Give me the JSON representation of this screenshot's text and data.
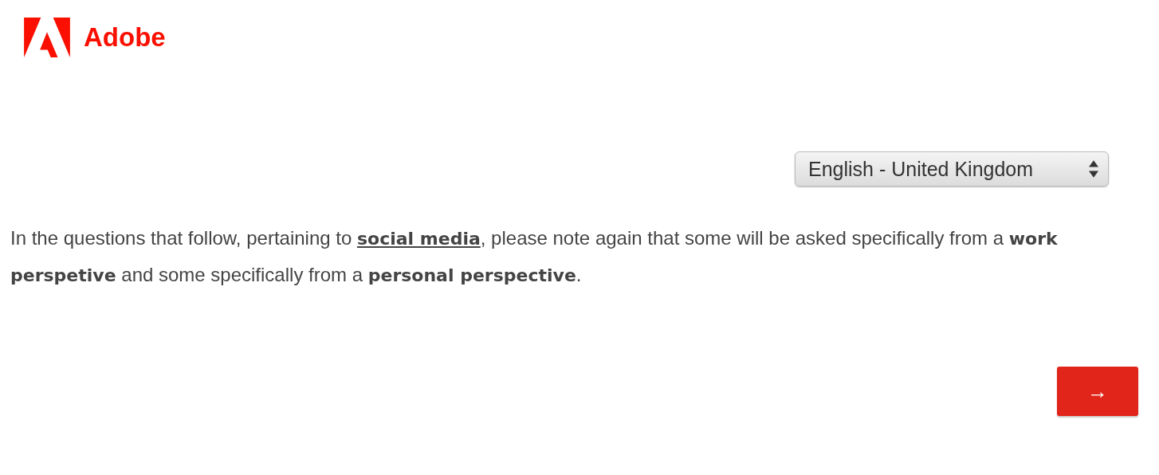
{
  "logo": {
    "name": "Adobe"
  },
  "language_select": {
    "value": "English - United Kingdom"
  },
  "intro": [
    {
      "kind": "text",
      "text": "In the questions that follow, pertaining to "
    },
    {
      "kind": "link",
      "text": "social media"
    },
    {
      "kind": "text",
      "text": ", please note again that some will be asked specifically from a "
    },
    {
      "kind": "bold",
      "text": "work perspetive"
    },
    {
      "kind": "text",
      "text": " and some specifically from a "
    },
    {
      "kind": "bold",
      "text": "personal perspective"
    },
    {
      "kind": "text",
      "text": "."
    }
  ],
  "next_button": {
    "label": "→"
  }
}
